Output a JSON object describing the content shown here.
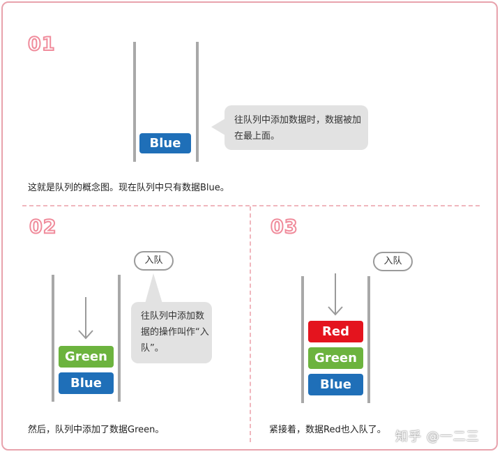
{
  "step1": {
    "number": "01",
    "block_blue": "Blue",
    "bubble": "往队列中添加数据时，数据被加在最上面。",
    "caption": "这就是队列的概念图。现在队列中只有数据Blue。"
  },
  "step2": {
    "number": "02",
    "pill": "入队",
    "block_green": "Green",
    "block_blue": "Blue",
    "bubble": "往队列中添加数据的操作叫作“入队”。",
    "caption": "然后，队列中添加了数据Green。"
  },
  "step3": {
    "number": "03",
    "pill": "入队",
    "block_red": "Red",
    "block_green": "Green",
    "block_blue": "Blue",
    "caption": "紧接着，数据Red也入队了。"
  },
  "watermark": "知乎 @一二三",
  "colors": {
    "frame": "#e8a2ac",
    "number_outline": "#f08b9b",
    "blue": "#1f6fb8",
    "green": "#6cb33e",
    "red": "#e4141e",
    "bubble": "#e2e2e2",
    "wall": "#a8a8a8"
  }
}
